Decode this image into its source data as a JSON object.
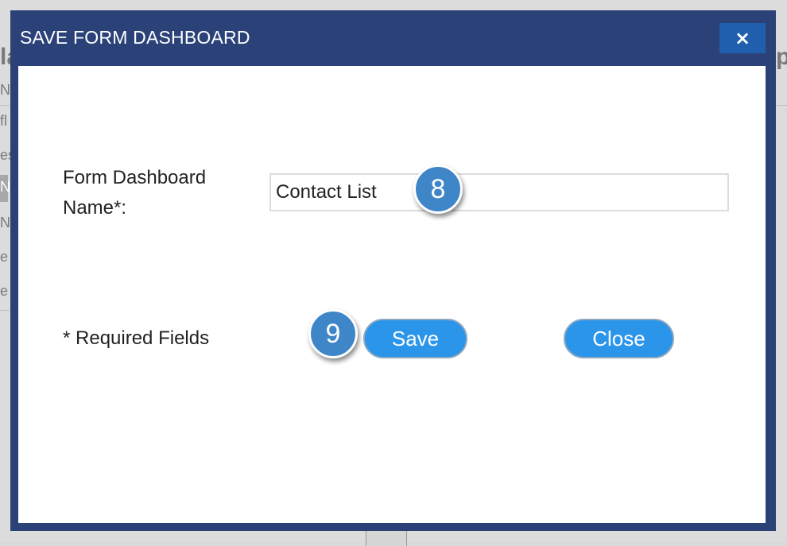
{
  "background": {
    "fragments": [
      "la",
      "N",
      "fl",
      "es",
      "N",
      "N",
      "e",
      "e",
      "p"
    ]
  },
  "modal": {
    "title": "SAVE FORM DASHBOARD",
    "close_icon": "×",
    "field_label": "Form Dashboard Name*:",
    "name_input": {
      "value": "Contact List",
      "placeholder": ""
    },
    "required_note": "* Required Fields",
    "save_label": "Save",
    "close_label": "Close"
  },
  "callouts": {
    "step_input": "8",
    "step_save": "9"
  },
  "colors": {
    "header_bg": "#2b4279",
    "close_icon_bg": "#1f5fae",
    "button_bg": "#2b95e9",
    "badge_bg": "#3f86c8"
  }
}
